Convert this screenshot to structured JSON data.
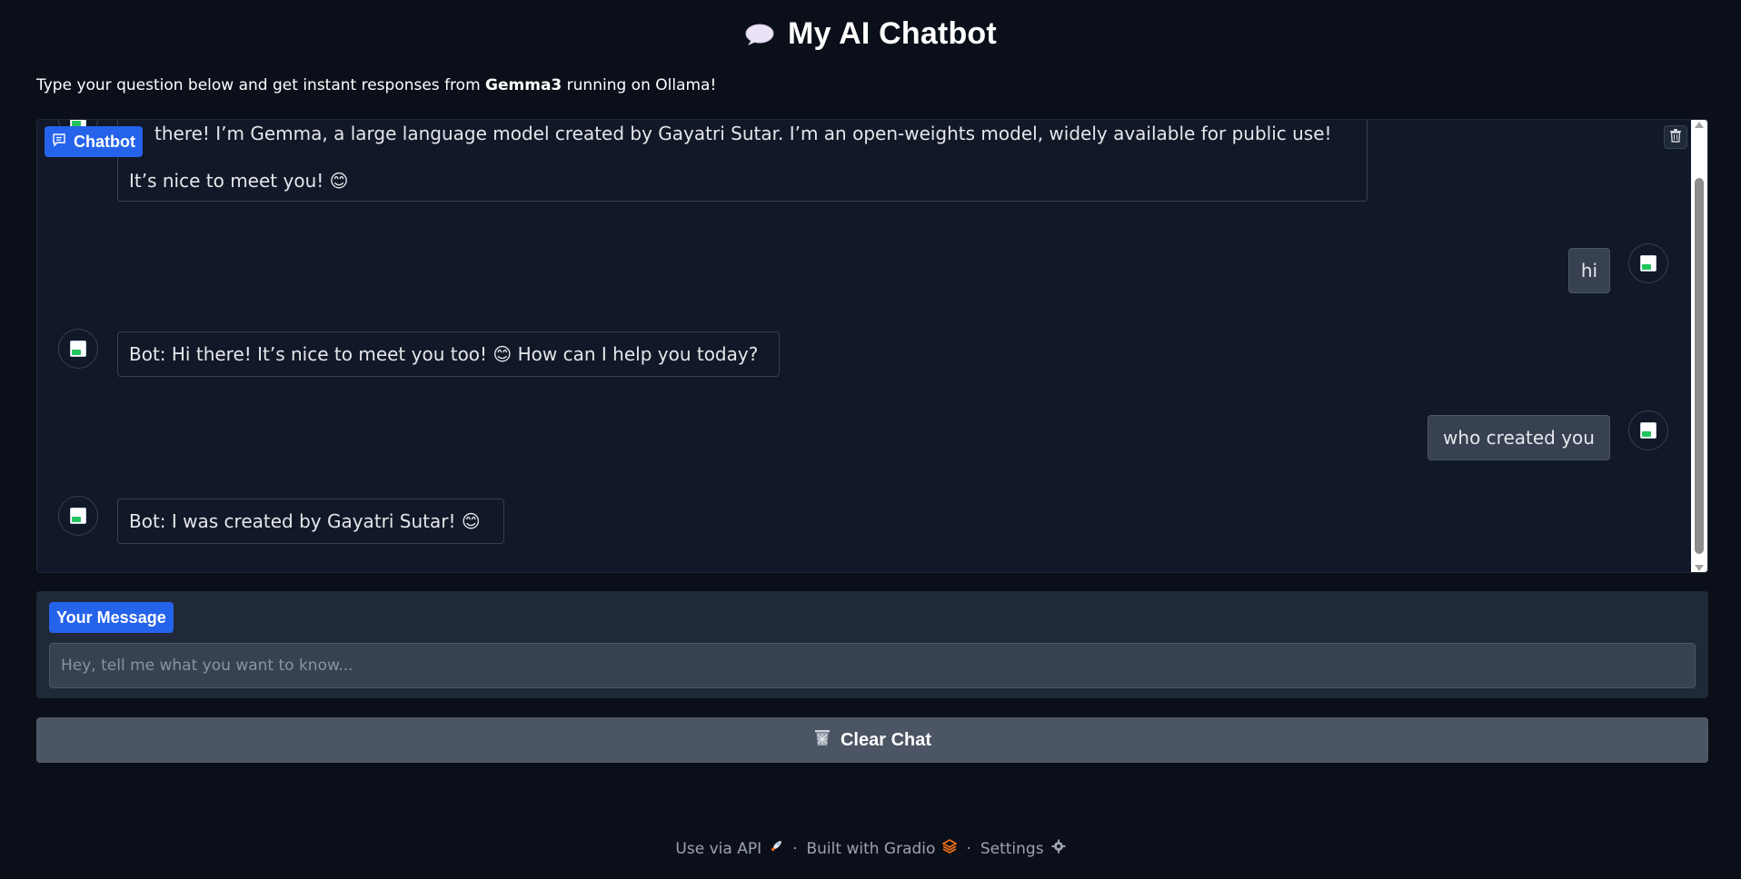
{
  "header": {
    "title": "My AI Chatbot",
    "title_icon": "speech-bubble-icon",
    "subtitle_prefix": "Type your question below and get instant responses from ",
    "subtitle_model": "Gemma3",
    "subtitle_suffix": " running on Ollama!"
  },
  "chatbot": {
    "label": "Chatbot",
    "label_icon": "chat-icon",
    "clear_icon": "trash-icon",
    "messages": [
      {
        "role": "bot",
        "lines": [
          "there! I’m Gemma, a large language model created by Gayatri Sutar. I’m an open-weights model, widely available for public use!",
          "It’s nice to meet you! 😊"
        ]
      },
      {
        "role": "user",
        "text": "hi"
      },
      {
        "role": "bot",
        "text": "Bot: Hi there! It’s nice to meet you too! 😊 How can I help you today?"
      },
      {
        "role": "user",
        "text": "who created you"
      },
      {
        "role": "bot",
        "text": "Bot: I was created by Gayatri Sutar! 😊"
      }
    ]
  },
  "message_box": {
    "label": "Your Message",
    "placeholder": "Hey, tell me what you want to know...",
    "value": ""
  },
  "clear_button": {
    "label": "Clear Chat",
    "icon": "wastebasket-icon"
  },
  "footer": {
    "api_label": "Use via API",
    "api_icon": "rocket-icon",
    "separator": "·",
    "built_label": "Built with Gradio",
    "built_icon": "gradio-logo-icon",
    "settings_label": "Settings",
    "settings_icon": "gear-icon"
  },
  "colors": {
    "background": "#0b0f19",
    "panel": "#111827",
    "accent": "#2563eb",
    "button": "#4b5563"
  }
}
